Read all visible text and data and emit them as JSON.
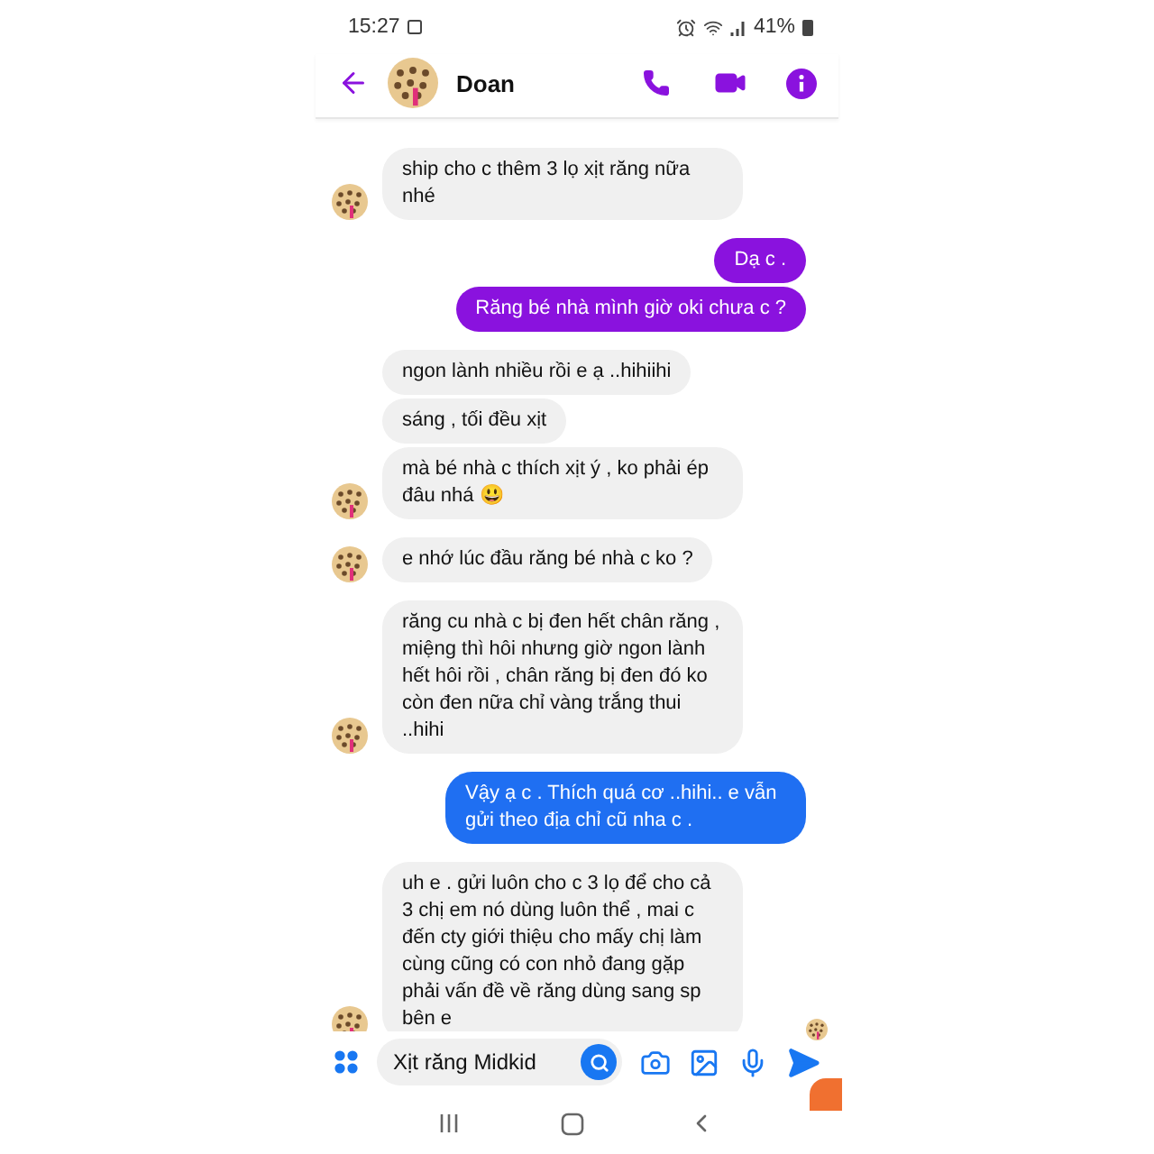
{
  "status_bar": {
    "time": "15:27",
    "battery": "41%"
  },
  "header": {
    "contact_name": "Doan"
  },
  "groups": [
    {
      "kind": "them",
      "avatar": true,
      "messages": [
        {
          "text": "ship cho c thêm 3 lọ xịt răng nữa nhé"
        }
      ]
    },
    {
      "kind": "me",
      "messages": [
        {
          "text": "Dạ c .",
          "color": "#8a12de"
        },
        {
          "text": "Răng bé nhà mình giờ oki chưa c ?",
          "color": "#8a12de"
        }
      ]
    },
    {
      "kind": "them",
      "avatar": true,
      "messages": [
        {
          "text": "ngon lành nhiều  rồi e ạ ..hihiihi"
        },
        {
          "text": "sáng , tối đều xịt"
        },
        {
          "text": "mà bé nhà c thích xịt ý , ko phải ép đâu nhá",
          "emoji": "😃"
        }
      ]
    },
    {
      "kind": "them",
      "avatar": true,
      "messages": [
        {
          "text": "e nhớ lúc đầu răng bé nhà c ko ?"
        }
      ]
    },
    {
      "kind": "them",
      "avatar": true,
      "messages": [
        {
          "text": "răng cu nhà c bị đen hết chân răng , miệng thì hôi nhưng giờ ngon lành hết hôi rồi , chân răng bị đen đó ko còn đen nữa chỉ vàng trắng thui ..hihi"
        }
      ]
    },
    {
      "kind": "me",
      "messages": [
        {
          "text": "Vậy ạ c . Thích quá cơ ..hihi.. e vẫn gửi theo địa chỉ cũ nha c .",
          "color": "#1f6ff2"
        }
      ]
    },
    {
      "kind": "them",
      "avatar": true,
      "messages": [
        {
          "text": "uh e . gửi luôn cho c 3 lọ để cho cả 3 chị em nó dùng luôn thể , mai c đến cty giới thiệu cho mấy chị làm cùng cũng có con nhỏ đang gặp phải vấn đề về răng dùng sang sp bên e"
        }
      ]
    }
  ],
  "composer": {
    "value": "Xịt răng Midkid"
  }
}
